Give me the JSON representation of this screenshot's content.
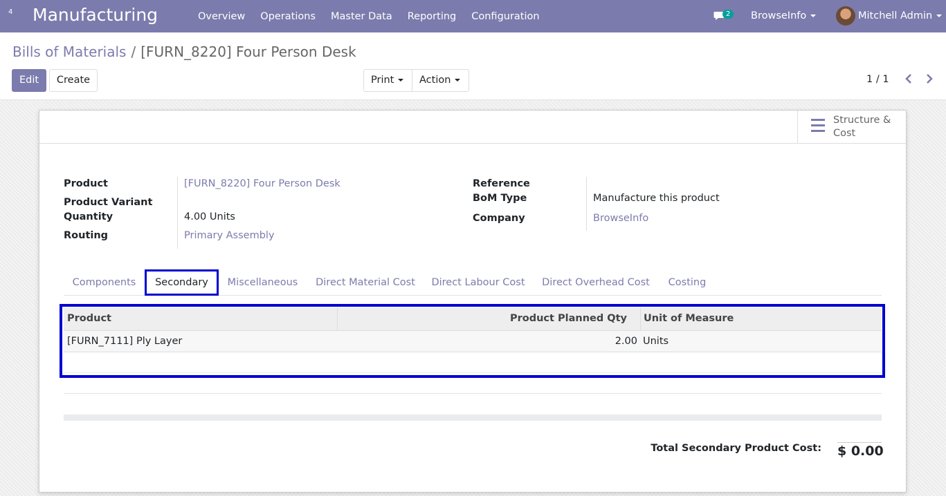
{
  "navbar": {
    "apps_badge": "4",
    "brand": "Manufacturing",
    "menu": [
      "Overview",
      "Operations",
      "Master Data",
      "Reporting",
      "Configuration"
    ],
    "messages_count": "2",
    "company": "BrowseInfo",
    "user": "Mitchell Admin",
    "accent_color": "#7c7bad"
  },
  "breadcrumb": {
    "parent": "Bills of Materials",
    "separator": "/",
    "current": "[FURN_8220] Four Person Desk"
  },
  "toolbar": {
    "edit_label": "Edit",
    "create_label": "Create",
    "print_label": "Print",
    "action_label": "Action",
    "pager": "1 / 1"
  },
  "smart_button": {
    "label": "Structure & Cost",
    "icon": "bars-icon"
  },
  "form": {
    "product_label": "Product",
    "product_value": "[FURN_8220] Four Person Desk",
    "variant_label": "Product Variant",
    "quantity_label": "Quantity",
    "quantity_value": "4.00",
    "quantity_uom": "Units",
    "routing_label": "Routing",
    "routing_value": "Primary Assembly",
    "reference_label": "Reference",
    "bom_type_label": "BoM Type",
    "bom_type_value": "Manufacture this product",
    "company_label": "Company",
    "company_value": "BrowseInfo"
  },
  "tabs": [
    {
      "label": "Components",
      "active": false
    },
    {
      "label": "Secondary",
      "active": true
    },
    {
      "label": "Miscellaneous",
      "active": false
    },
    {
      "label": "Direct Material Cost",
      "active": false
    },
    {
      "label": "Direct Labour Cost",
      "active": false
    },
    {
      "label": "Direct Overhead Cost",
      "active": false
    },
    {
      "label": "Costing",
      "active": false
    }
  ],
  "secondary_table": {
    "headers": [
      "Product",
      "Product Planned Qty",
      "Unit of Measure"
    ],
    "rows": [
      {
        "product": "[FURN_7111] Ply Layer",
        "qty": "2.00",
        "uom": "Units"
      }
    ]
  },
  "totals": {
    "secondary_cost_label": "Total Secondary Product Cost:",
    "secondary_cost_value": "$ 0.00"
  },
  "highlight_color": "#0000d0"
}
